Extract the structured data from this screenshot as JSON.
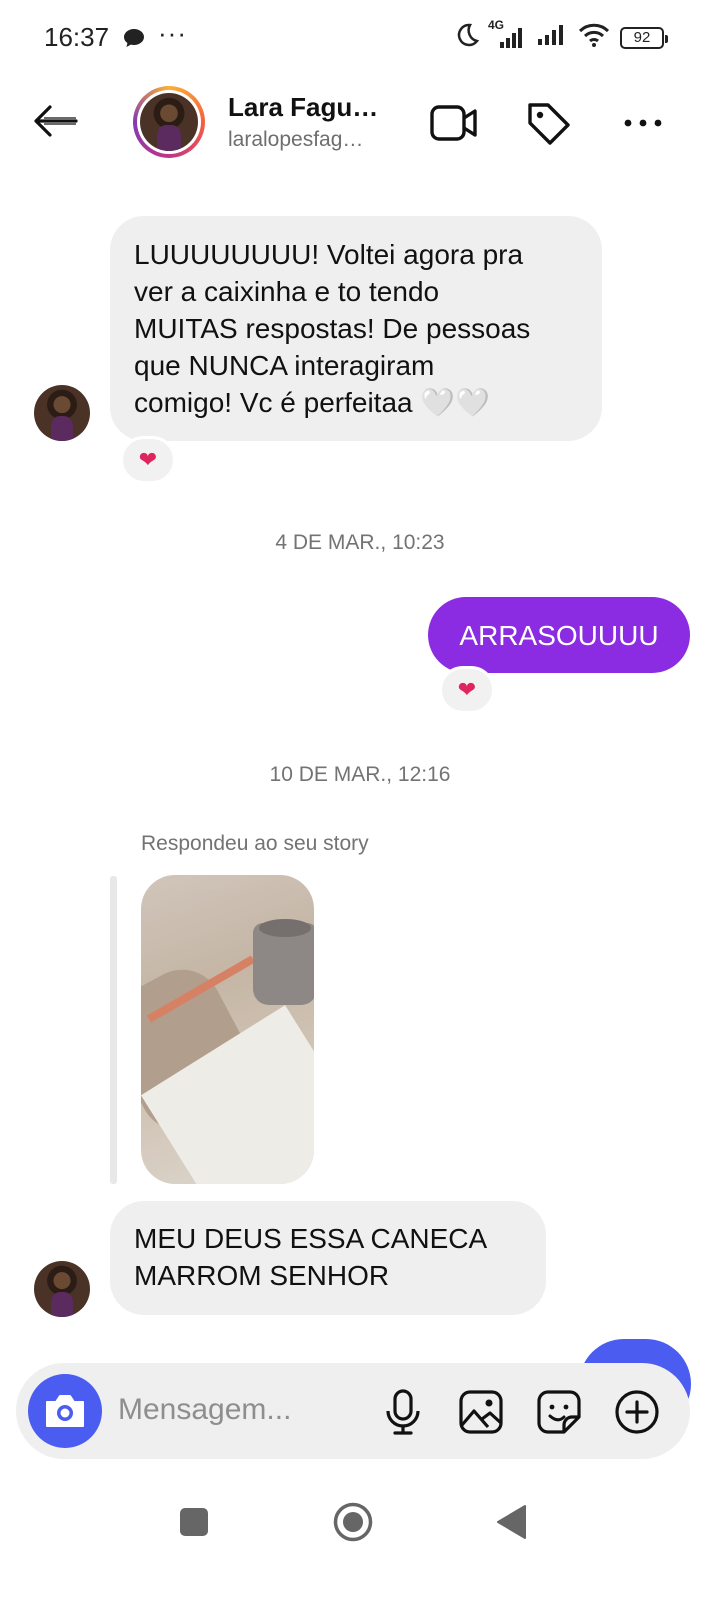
{
  "status_bar": {
    "time": "16:37",
    "dots": "···",
    "network_type": "4G",
    "battery_level": "92"
  },
  "header": {
    "name": "Lara Fagu…",
    "username": "laralopesfag…"
  },
  "messages": [
    {
      "direction": "incoming",
      "lines": [
        "LUUUUUUUU! Voltei agora pra",
        "ver a caixinha e to tendo",
        "MUITAS respostas! De pessoas",
        "que NUNCA interagiram",
        "comigo! Vc é perfeitaa 🤍🤍"
      ],
      "reaction": "❤"
    },
    {
      "direction": "outgoing",
      "text": "ARRASOUUUU",
      "reaction": "❤"
    },
    {
      "direction": "incoming",
      "lines": [
        "MEU DEUS ESSA CANECA",
        "MARROM SENHOR"
      ]
    }
  ],
  "timestamps": [
    "4 DE MAR., 10:23",
    "10 DE MAR., 12:16"
  ],
  "story_reply_label": "Respondeu ao seu story",
  "composer": {
    "placeholder": "Mensagem..."
  },
  "colors": {
    "outgoing_bubble": "#8b2be2",
    "incoming_bubble": "#efefef",
    "accent_blue": "#4b5cf0",
    "reaction_heart": "#e0245e"
  },
  "icons": {
    "header": [
      "back-arrow-icon",
      "video-call-icon",
      "tag-icon",
      "more-options-icon"
    ],
    "composer": [
      "camera-icon",
      "microphone-icon",
      "gallery-icon",
      "sticker-icon",
      "add-icon"
    ],
    "nav": [
      "recent-apps-icon",
      "home-icon",
      "back-icon"
    ]
  }
}
